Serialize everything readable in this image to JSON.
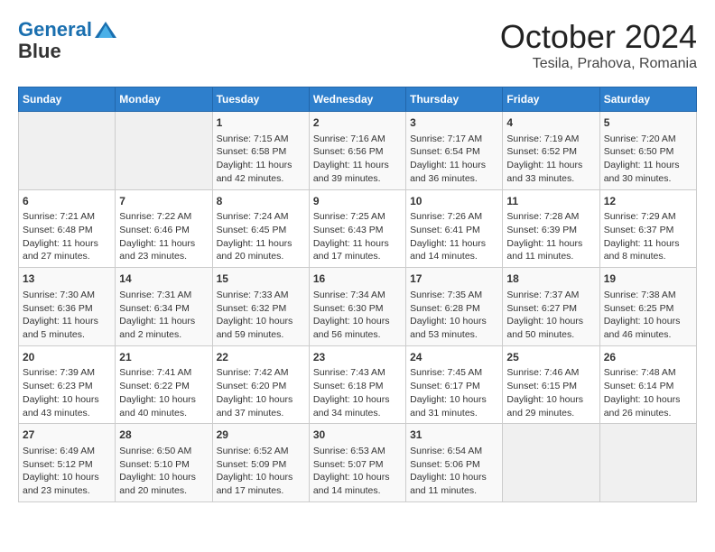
{
  "logo": {
    "line1": "General",
    "line2": "Blue"
  },
  "title": "October 2024",
  "location": "Tesila, Prahova, Romania",
  "days_header": [
    "Sunday",
    "Monday",
    "Tuesday",
    "Wednesday",
    "Thursday",
    "Friday",
    "Saturday"
  ],
  "weeks": [
    [
      {
        "day": "",
        "empty": true
      },
      {
        "day": "",
        "empty": true
      },
      {
        "day": "1",
        "sunrise": "7:15 AM",
        "sunset": "6:58 PM",
        "daylight": "11 hours and 42 minutes."
      },
      {
        "day": "2",
        "sunrise": "7:16 AM",
        "sunset": "6:56 PM",
        "daylight": "11 hours and 39 minutes."
      },
      {
        "day": "3",
        "sunrise": "7:17 AM",
        "sunset": "6:54 PM",
        "daylight": "11 hours and 36 minutes."
      },
      {
        "day": "4",
        "sunrise": "7:19 AM",
        "sunset": "6:52 PM",
        "daylight": "11 hours and 33 minutes."
      },
      {
        "day": "5",
        "sunrise": "7:20 AM",
        "sunset": "6:50 PM",
        "daylight": "11 hours and 30 minutes."
      }
    ],
    [
      {
        "day": "6",
        "sunrise": "7:21 AM",
        "sunset": "6:48 PM",
        "daylight": "11 hours and 27 minutes."
      },
      {
        "day": "7",
        "sunrise": "7:22 AM",
        "sunset": "6:46 PM",
        "daylight": "11 hours and 23 minutes."
      },
      {
        "day": "8",
        "sunrise": "7:24 AM",
        "sunset": "6:45 PM",
        "daylight": "11 hours and 20 minutes."
      },
      {
        "day": "9",
        "sunrise": "7:25 AM",
        "sunset": "6:43 PM",
        "daylight": "11 hours and 17 minutes."
      },
      {
        "day": "10",
        "sunrise": "7:26 AM",
        "sunset": "6:41 PM",
        "daylight": "11 hours and 14 minutes."
      },
      {
        "day": "11",
        "sunrise": "7:28 AM",
        "sunset": "6:39 PM",
        "daylight": "11 hours and 11 minutes."
      },
      {
        "day": "12",
        "sunrise": "7:29 AM",
        "sunset": "6:37 PM",
        "daylight": "11 hours and 8 minutes."
      }
    ],
    [
      {
        "day": "13",
        "sunrise": "7:30 AM",
        "sunset": "6:36 PM",
        "daylight": "11 hours and 5 minutes."
      },
      {
        "day": "14",
        "sunrise": "7:31 AM",
        "sunset": "6:34 PM",
        "daylight": "11 hours and 2 minutes."
      },
      {
        "day": "15",
        "sunrise": "7:33 AM",
        "sunset": "6:32 PM",
        "daylight": "10 hours and 59 minutes."
      },
      {
        "day": "16",
        "sunrise": "7:34 AM",
        "sunset": "6:30 PM",
        "daylight": "10 hours and 56 minutes."
      },
      {
        "day": "17",
        "sunrise": "7:35 AM",
        "sunset": "6:28 PM",
        "daylight": "10 hours and 53 minutes."
      },
      {
        "day": "18",
        "sunrise": "7:37 AM",
        "sunset": "6:27 PM",
        "daylight": "10 hours and 50 minutes."
      },
      {
        "day": "19",
        "sunrise": "7:38 AM",
        "sunset": "6:25 PM",
        "daylight": "10 hours and 46 minutes."
      }
    ],
    [
      {
        "day": "20",
        "sunrise": "7:39 AM",
        "sunset": "6:23 PM",
        "daylight": "10 hours and 43 minutes."
      },
      {
        "day": "21",
        "sunrise": "7:41 AM",
        "sunset": "6:22 PM",
        "daylight": "10 hours and 40 minutes."
      },
      {
        "day": "22",
        "sunrise": "7:42 AM",
        "sunset": "6:20 PM",
        "daylight": "10 hours and 37 minutes."
      },
      {
        "day": "23",
        "sunrise": "7:43 AM",
        "sunset": "6:18 PM",
        "daylight": "10 hours and 34 minutes."
      },
      {
        "day": "24",
        "sunrise": "7:45 AM",
        "sunset": "6:17 PM",
        "daylight": "10 hours and 31 minutes."
      },
      {
        "day": "25",
        "sunrise": "7:46 AM",
        "sunset": "6:15 PM",
        "daylight": "10 hours and 29 minutes."
      },
      {
        "day": "26",
        "sunrise": "7:48 AM",
        "sunset": "6:14 PM",
        "daylight": "10 hours and 26 minutes."
      }
    ],
    [
      {
        "day": "27",
        "sunrise": "6:49 AM",
        "sunset": "5:12 PM",
        "daylight": "10 hours and 23 minutes."
      },
      {
        "day": "28",
        "sunrise": "6:50 AM",
        "sunset": "5:10 PM",
        "daylight": "10 hours and 20 minutes."
      },
      {
        "day": "29",
        "sunrise": "6:52 AM",
        "sunset": "5:09 PM",
        "daylight": "10 hours and 17 minutes."
      },
      {
        "day": "30",
        "sunrise": "6:53 AM",
        "sunset": "5:07 PM",
        "daylight": "10 hours and 14 minutes."
      },
      {
        "day": "31",
        "sunrise": "6:54 AM",
        "sunset": "5:06 PM",
        "daylight": "10 hours and 11 minutes."
      },
      {
        "day": "",
        "empty": true
      },
      {
        "day": "",
        "empty": true
      }
    ]
  ],
  "labels": {
    "sunrise": "Sunrise:",
    "sunset": "Sunset:",
    "daylight": "Daylight:"
  }
}
